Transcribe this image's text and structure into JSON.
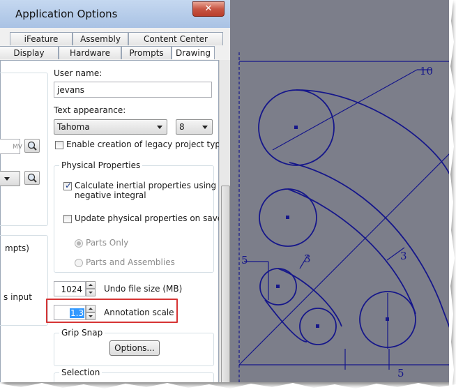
{
  "dialog": {
    "title": "Application Options",
    "close_glyph": "✕",
    "tabs_row1": [
      {
        "label": "iFeature"
      },
      {
        "label": "Assembly"
      },
      {
        "label": "Content Center"
      }
    ],
    "tabs_row2": [
      {
        "label": "Display"
      },
      {
        "label": "Hardware"
      },
      {
        "label": "Prompts"
      },
      {
        "label": "Drawing"
      }
    ],
    "left_fragments": {
      "prompts_fragment": "mpts)",
      "input_fragment": "s input",
      "field_fragment": "MV"
    },
    "user_name": {
      "label": "User name:",
      "value": "jevans"
    },
    "text_appearance": {
      "label": "Text appearance:",
      "font": "Tahoma",
      "size": "8"
    },
    "legacy_projects": {
      "label": "Enable creation of legacy project types",
      "checked": false
    },
    "physical_properties": {
      "legend": "Physical Properties",
      "calc_inertial": {
        "label_line1": "Calculate inertial properties using",
        "label_line2": "negative integral",
        "checked": true
      },
      "update_on_save": {
        "label": "Update physical properties on save",
        "checked": false
      },
      "parts_only": {
        "label": "Parts Only",
        "selected": true,
        "enabled": false
      },
      "parts_and_assemblies": {
        "label": "Parts and Assemblies",
        "selected": false,
        "enabled": false
      }
    },
    "undo_file_size": {
      "value": "1024",
      "label": "Undo file size (MB)"
    },
    "annotation_scale": {
      "value": "1.3",
      "label": "Annotation scale"
    },
    "grip_snap": {
      "legend": "Grip Snap",
      "options_button": "Options..."
    },
    "selection": {
      "legend": "Selection"
    }
  },
  "drawing": {
    "line_color": "#16178a",
    "background_color": "#7c7e8a",
    "dimensions": [
      "10",
      "5",
      "3",
      "3",
      "5"
    ]
  },
  "colors": {
    "highlight_box": "#d63434",
    "title_bar": "#a9c2e4"
  }
}
